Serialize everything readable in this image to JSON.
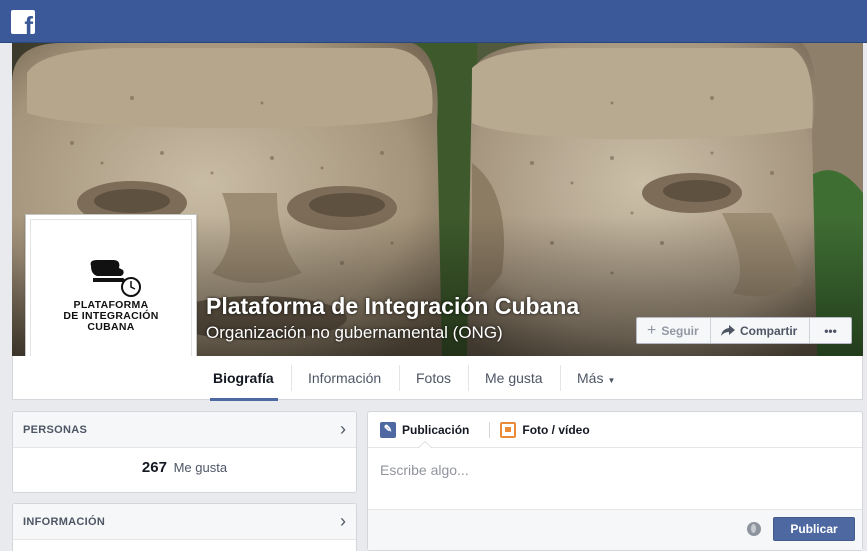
{
  "topbar": {
    "logo": "f"
  },
  "page": {
    "name": "Plataforma de Integración Cubana",
    "category": "Organización no gubernamental (ONG)",
    "logo_lines": [
      "PLATAFORMA",
      "DE INTEGRACIÓN",
      "CUBANA"
    ]
  },
  "actions": {
    "follow": "Seguir",
    "share": "Compartir",
    "more": "•••"
  },
  "tabs": [
    {
      "label": "Biografía",
      "active": true
    },
    {
      "label": "Información"
    },
    {
      "label": "Fotos"
    },
    {
      "label": "Me gusta"
    },
    {
      "label": "Más"
    }
  ],
  "people": {
    "title": "PERSONAS",
    "count": "267",
    "count_label": "Me gusta"
  },
  "info": {
    "title": "INFORMACIÓN"
  },
  "composer": {
    "tab_post": "Publicación",
    "tab_photo": "Foto / vídeo",
    "placeholder": "Escribe algo...",
    "publish": "Publicar"
  },
  "icons": [
    "facebook-logo-icon",
    "plus-icon",
    "share-arrow-icon",
    "more-dots-icon",
    "chevron-right-icon",
    "pencil-icon",
    "photo-icon",
    "globe-icon",
    "caret-down-icon"
  ]
}
